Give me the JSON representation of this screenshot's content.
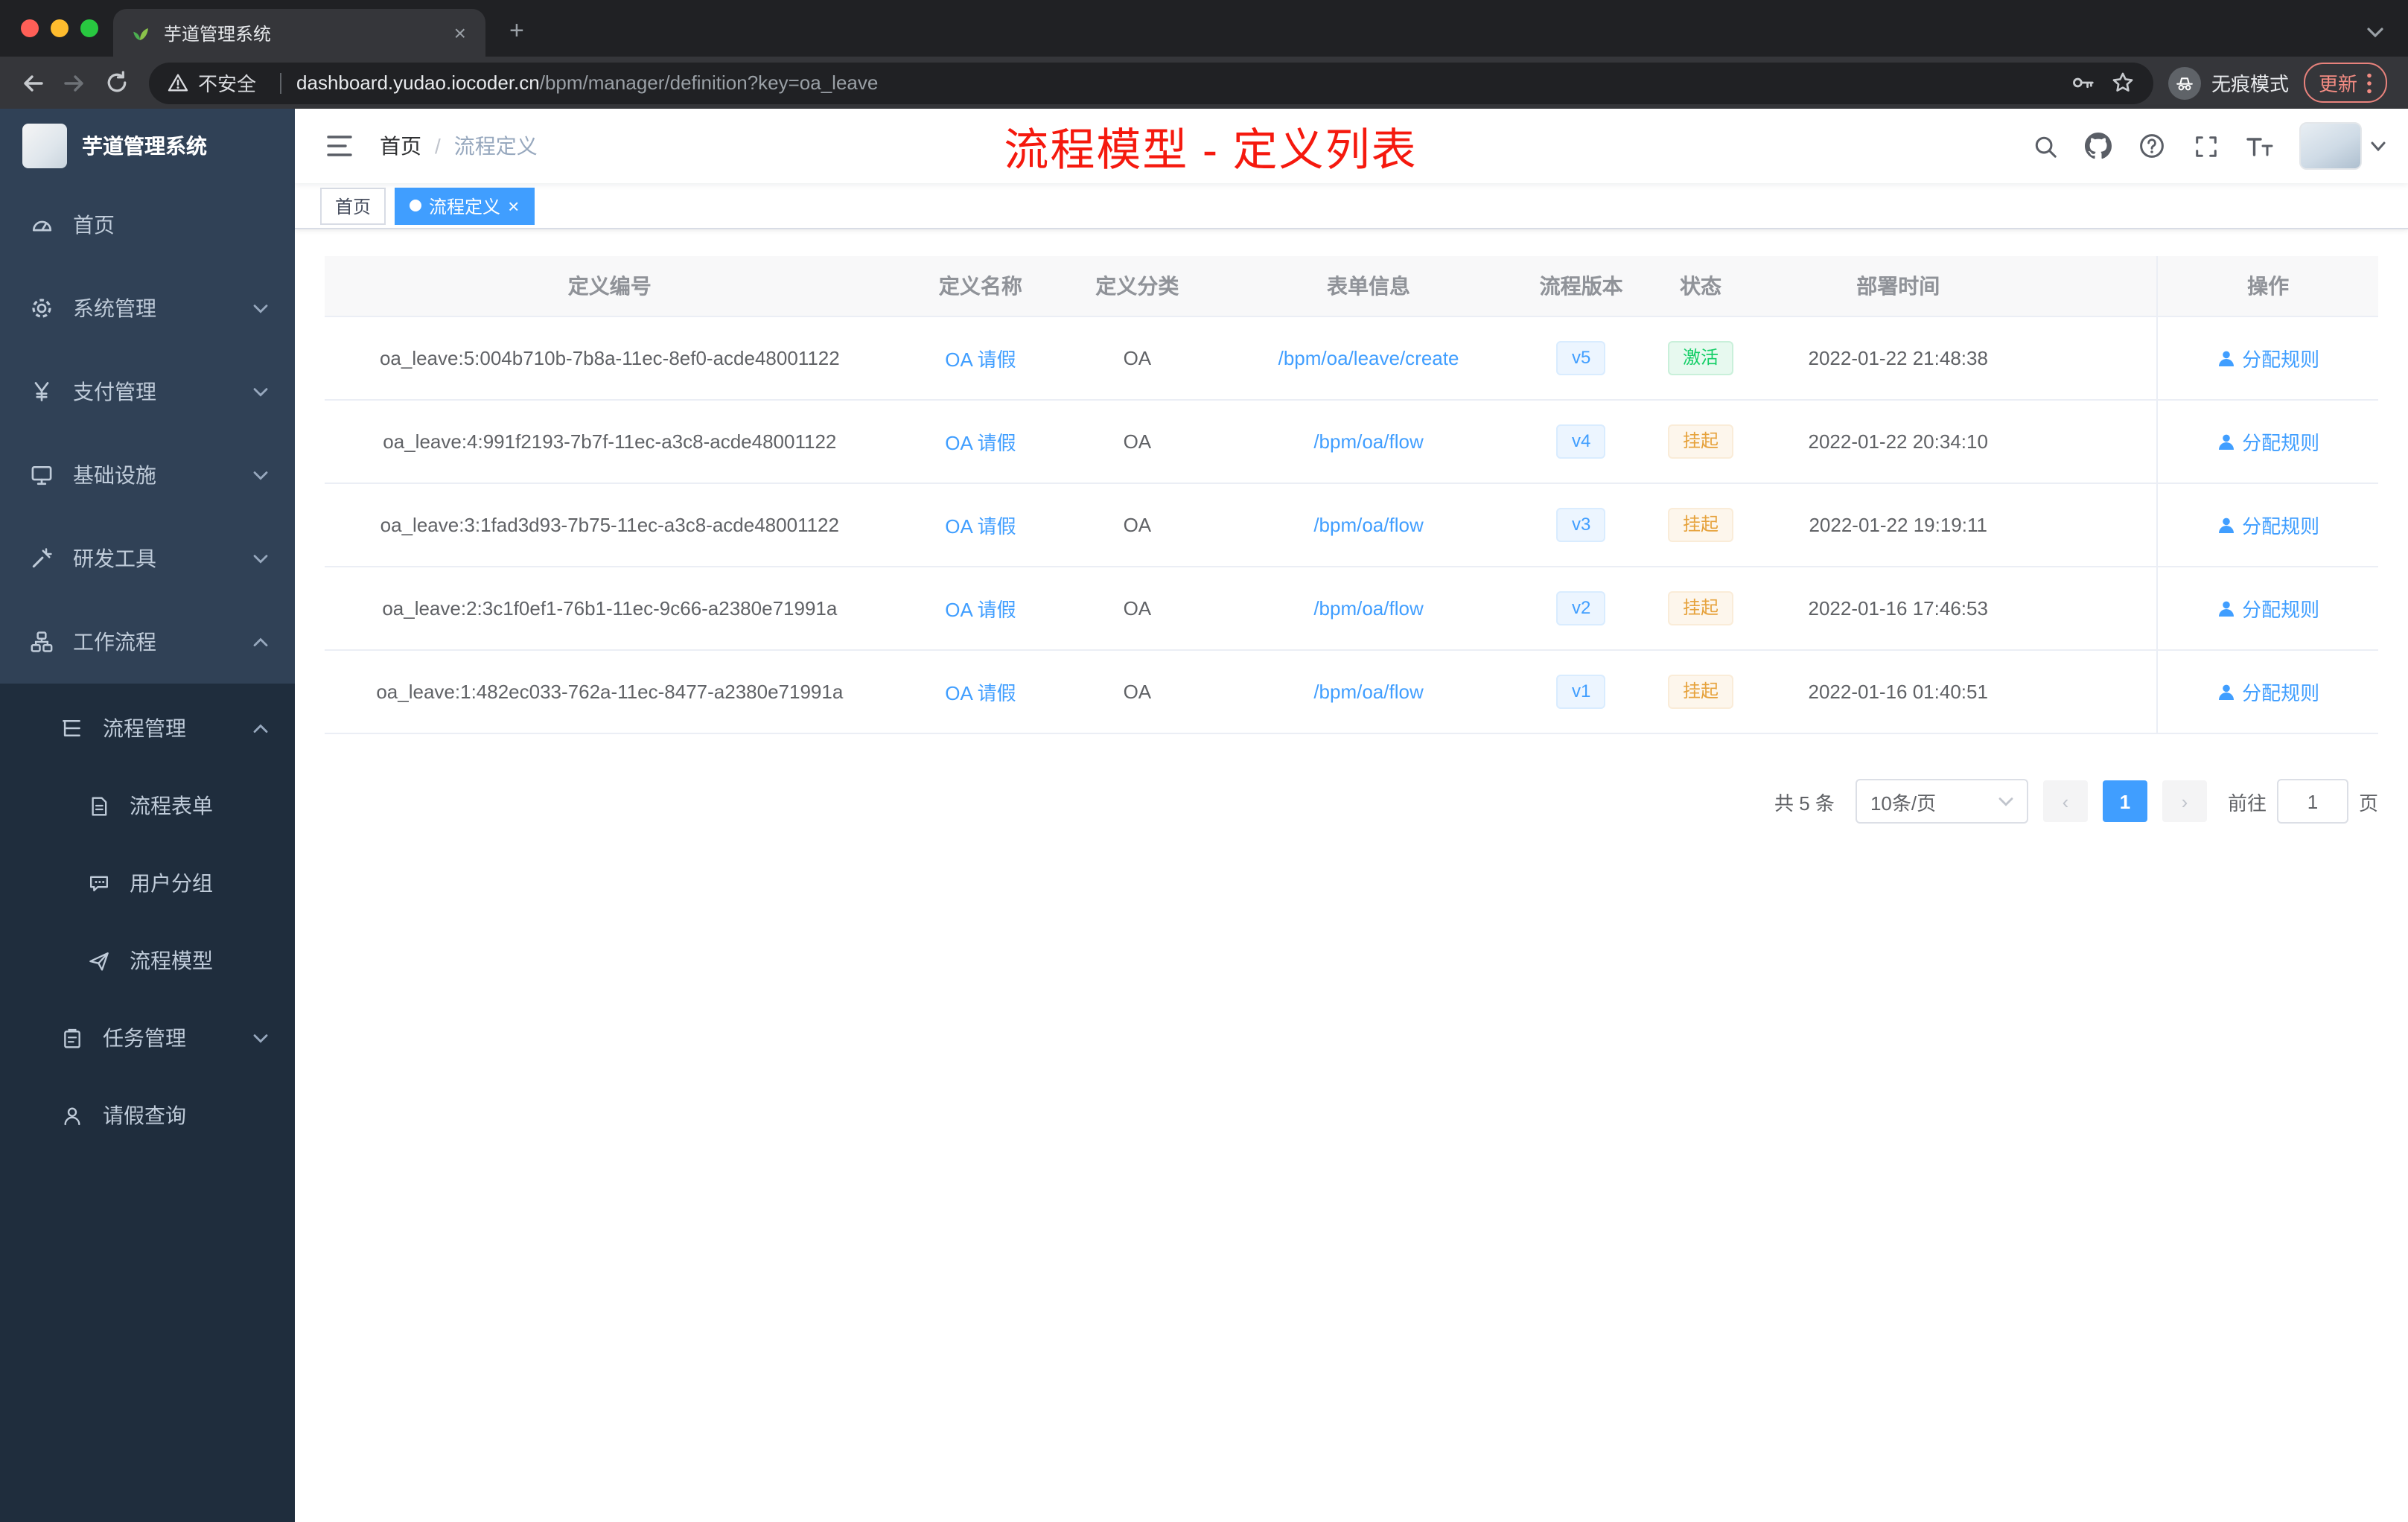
{
  "browser": {
    "tab_title": "芋道管理系统",
    "security_label": "不安全",
    "url_host": "dashboard.yudao.iocoder.cn",
    "url_path": "/bpm/manager/definition?key=oa_leave",
    "incognito_label": "无痕模式",
    "update_label": "更新"
  },
  "glyphs": {
    "close": "×",
    "plus": "+",
    "prev": "‹",
    "next": "›"
  },
  "sidebar": {
    "logo_title": "芋道管理系统",
    "items": [
      {
        "label": "首页"
      },
      {
        "label": "系统管理"
      },
      {
        "label": "支付管理"
      },
      {
        "label": "基础设施"
      },
      {
        "label": "研发工具"
      },
      {
        "label": "工作流程"
      }
    ],
    "submenu": {
      "process": {
        "label": "流程管理",
        "children": [
          {
            "label": "流程表单"
          },
          {
            "label": "用户分组"
          },
          {
            "label": "流程模型"
          }
        ]
      },
      "task": {
        "label": "任务管理"
      },
      "leave": {
        "label": "请假查询"
      }
    }
  },
  "header": {
    "breadcrumb_home": "首页",
    "breadcrumb_separator": "/",
    "breadcrumb_current": "流程定义",
    "annotation": "流程模型 - 定义列表"
  },
  "tags": {
    "home": "首页",
    "active": "流程定义"
  },
  "table": {
    "columns": [
      "定义编号",
      "定义名称",
      "定义分类",
      "表单信息",
      "流程版本",
      "状态",
      "部署时间",
      "操作"
    ],
    "rows": [
      {
        "id": "oa_leave:5:004b710b-7b8a-11ec-8ef0-acde48001122",
        "name": "OA 请假",
        "category": "OA",
        "form": "/bpm/oa/leave/create",
        "version": "v5",
        "status": "激活",
        "time": "2022-01-22 21:48:38",
        "action": "分配规则"
      },
      {
        "id": "oa_leave:4:991f2193-7b7f-11ec-a3c8-acde48001122",
        "name": "OA 请假",
        "category": "OA",
        "form": "/bpm/oa/flow",
        "version": "v4",
        "status": "挂起",
        "time": "2022-01-22 20:34:10",
        "action": "分配规则"
      },
      {
        "id": "oa_leave:3:1fad3d93-7b75-11ec-a3c8-acde48001122",
        "name": "OA 请假",
        "category": "OA",
        "form": "/bpm/oa/flow",
        "version": "v3",
        "status": "挂起",
        "time": "2022-01-22 19:19:11",
        "action": "分配规则"
      },
      {
        "id": "oa_leave:2:3c1f0ef1-76b1-11ec-9c66-a2380e71991a",
        "name": "OA 请假",
        "category": "OA",
        "form": "/bpm/oa/flow",
        "version": "v2",
        "status": "挂起",
        "time": "2022-01-16 17:46:53",
        "action": "分配规则"
      },
      {
        "id": "oa_leave:1:482ec033-762a-11ec-8477-a2380e71991a",
        "name": "OA 请假",
        "category": "OA",
        "form": "/bpm/oa/flow",
        "version": "v1",
        "status": "挂起",
        "time": "2022-01-16 01:40:51",
        "action": "分配规则"
      }
    ]
  },
  "pagination": {
    "total": "共 5 条",
    "page_size": "10条/页",
    "current_page": "1",
    "goto_label": "前往",
    "goto_value": "1",
    "page_unit": "页"
  },
  "colors": {
    "accent": "#409eff",
    "success": "#13ce66",
    "warning": "#e6a23c",
    "annotation": "#f5190e",
    "sidebar": "#304156",
    "sidebar_sub": "#1f2d3d"
  }
}
